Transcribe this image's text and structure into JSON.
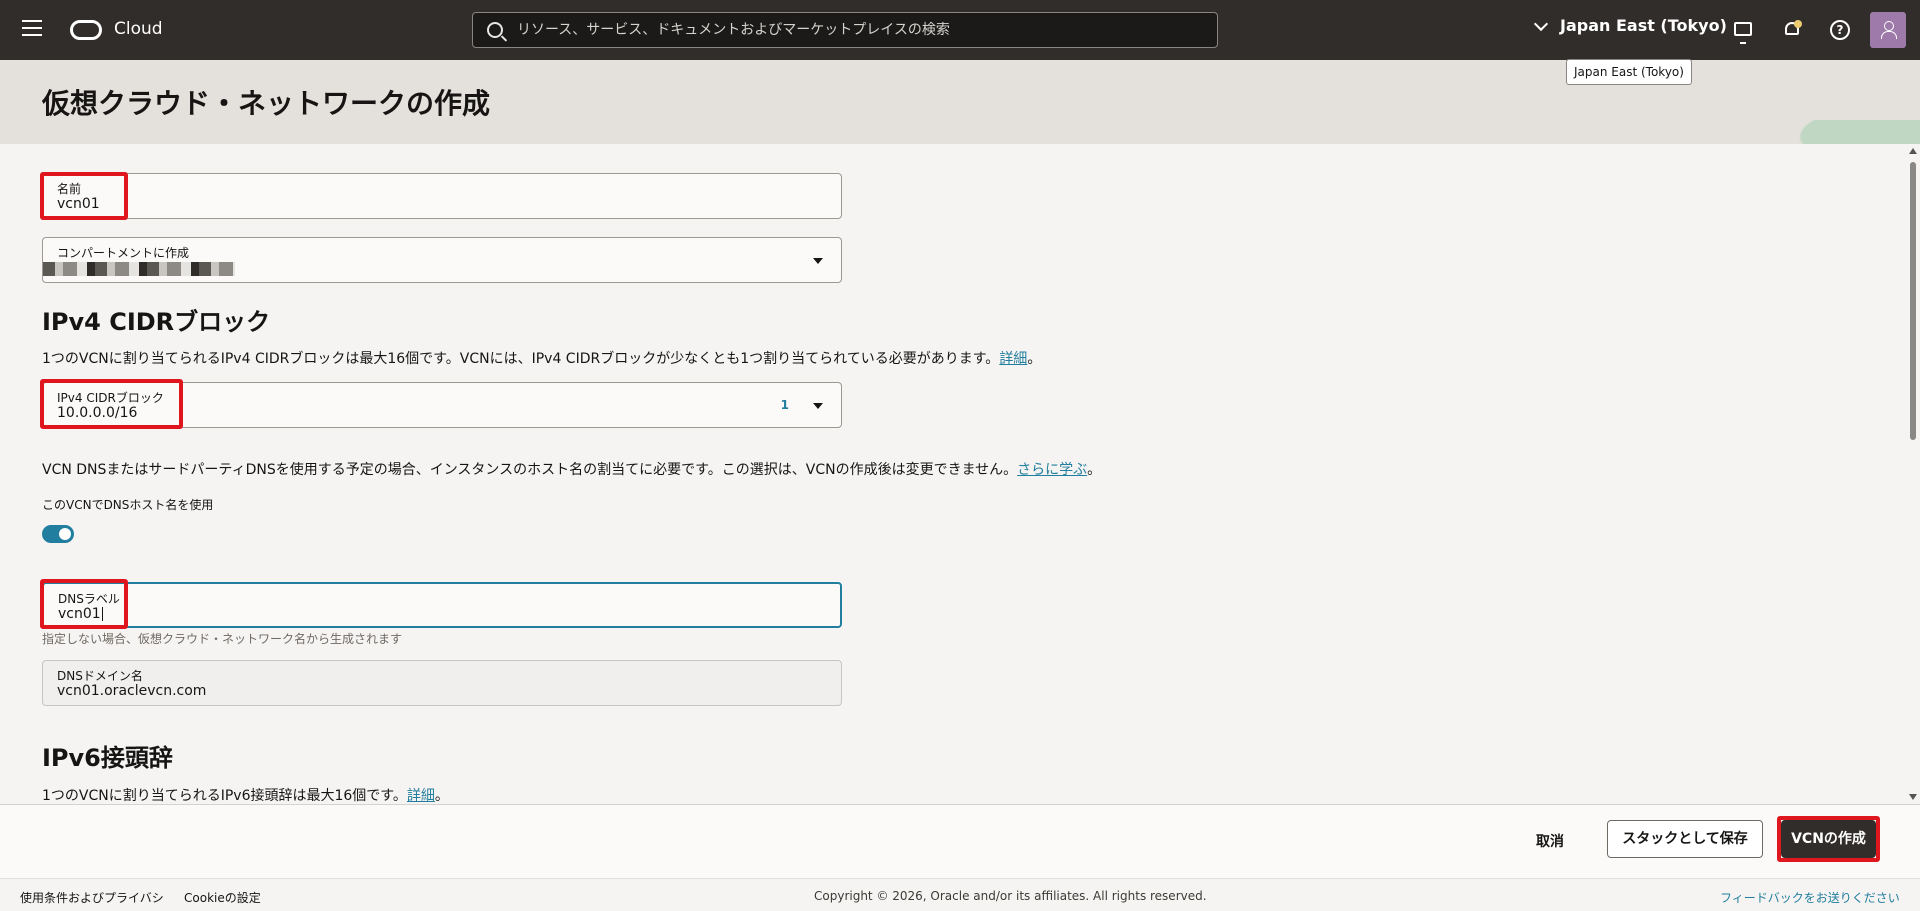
{
  "header": {
    "brand": "Cloud",
    "search_placeholder": "リソース、サービス、ドキュメントおよびマーケットプレイスの検索",
    "region": "Japan East (Tokyo)",
    "region_tooltip": "Japan East (Tokyo)",
    "help_glyph": "?"
  },
  "page": {
    "title": "仮想クラウド・ネットワークの作成"
  },
  "form": {
    "name": {
      "label": "名前",
      "value": "vcn01"
    },
    "compartment": {
      "label": "コンパートメントに作成"
    },
    "ipv4": {
      "heading": "IPv4 CIDRブロック",
      "desc": "1つのVCNに割り当てられるIPv4 CIDRブロックは最大16個です。VCNには、IPv4 CIDRブロックが少なくとも1つ割り当てられている必要があります。",
      "desc_link": "詳細",
      "desc_end": "。",
      "field_label": "IPv4 CIDRブロック",
      "field_value": "10.0.0.0/16",
      "count": "1"
    },
    "dns": {
      "desc": "VCN DNSまたはサードパーティDNSを使用する予定の場合、インスタンスのホスト名の割当てに必要です。この選択は、VCNの作成後は変更できません。",
      "desc_link": "さらに学ぶ",
      "desc_end": "。",
      "toggle_label": "このVCNでDNSホスト名を使用",
      "toggle_on": true,
      "label_field": {
        "label": "DNSラベル",
        "value": "vcn01"
      },
      "label_help": "指定しない場合、仮想クラウド・ネットワーク名から生成されます",
      "domain_field": {
        "label": "DNSドメイン名",
        "value": "vcn01.oraclevcn.com"
      }
    },
    "ipv6": {
      "heading": "IPv6接頭辞",
      "desc": "1つのVCNに割り当てられるIPv6接頭辞は最大16個です。",
      "desc_link": "詳細",
      "desc_end": "。"
    }
  },
  "actions": {
    "cancel": "取消",
    "save_stack": "スタックとして保存",
    "create": "VCNの作成"
  },
  "footer": {
    "terms": "使用条件およびプライバシ",
    "cookies": "Cookieの設定",
    "copyright": "Copyright © 2026, Oracle and/or its affiliates. All rights reserved.",
    "feedback": "フィードバックをお送りください"
  },
  "colors": {
    "header_bg": "#312d2a",
    "accent": "#227e9e",
    "highlight": "#e0161e"
  }
}
